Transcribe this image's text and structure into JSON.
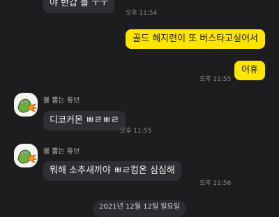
{
  "messages": [
    {
      "text": "야 반갑 볼 ㅜㅜ",
      "time": "오후 11:54"
    },
    {
      "text": "골드 혜지련이 또 버스타고싶어서",
      "time": ""
    },
    {
      "text": "어휴",
      "time": "오후 11:55"
    },
    {
      "sender": "불 뿜는 튜브",
      "text": "디코커몬 ㅃㄹㅃㄹ",
      "time": "오후 11:55"
    },
    {
      "sender": "불 뿜는 튜브",
      "text": "뭐해 소추새끼야 ㅃㄹ컴온 심심해",
      "time": "오후 11:56"
    }
  ],
  "date_divider": "2021년 12월 12일 일요일",
  "colors": {
    "background": "#1d1d1f",
    "incoming_bubble": "#2f2f33",
    "outgoing_bubble": "#fee500"
  },
  "icons": {
    "avatar": "fire-breathing-tube-avatar-icon"
  }
}
